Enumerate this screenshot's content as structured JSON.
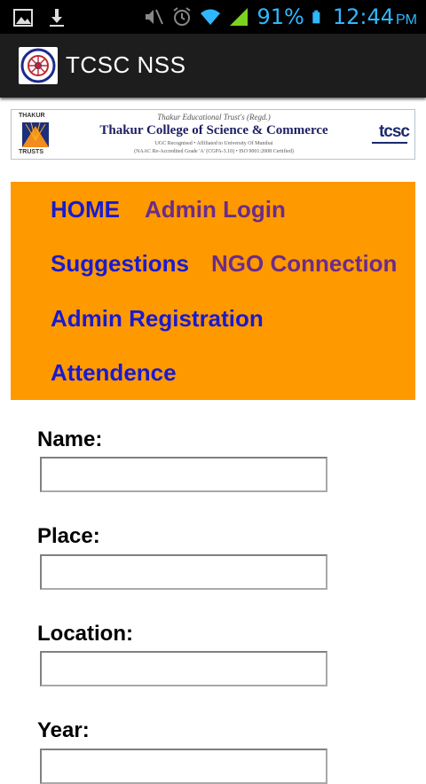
{
  "status_bar": {
    "battery": "91%",
    "time": "12:44",
    "ampm": "PM",
    "icons": [
      "image-icon",
      "download-icon",
      "mute-icon",
      "alarm-icon",
      "wifi-icon",
      "signal-icon",
      "battery-icon"
    ]
  },
  "action_bar": {
    "title": "TCSC NSS",
    "icon": "nss-logo-icon"
  },
  "banner": {
    "left_top": "THAKUR",
    "left_bottom": "TRUSTS",
    "trust_line": "Thakur Educational Trust's (Regd.)",
    "college": "Thakur College of Science & Commerce",
    "sub1": "UGC Recognised • Affiliated to University Of Mumbai",
    "sub2": "(NAAC Re-Accredited Grade 'A' (CGPA-3.10) • ISO 9001:2008 Certified)",
    "right_logo": "tcsc"
  },
  "nav": {
    "home": "HOME",
    "admin_login": "Admin Login",
    "suggestions": "Suggestions",
    "ngo_connection": "NGO Connection",
    "admin_registration": "Admin Registration",
    "attendence": "Attendence"
  },
  "form": {
    "name_label": "Name:",
    "name_value": "",
    "place_label": "Place:",
    "place_value": "",
    "location_label": "Location:",
    "location_value": "",
    "year_label": "Year:",
    "year_value": ""
  },
  "colors": {
    "nav_bg": "#ff9900",
    "link_blue": "#1a1acf",
    "link_purple": "#6b2c8a",
    "status_accent": "#2fb8ff",
    "action_bar_bg": "#1d1d1d"
  }
}
